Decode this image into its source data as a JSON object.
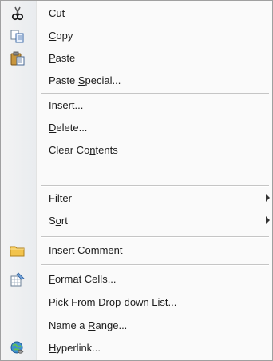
{
  "menu": {
    "items": [
      {
        "pre": "Cu",
        "mn": "t",
        "post": "",
        "icon": "cut-icon"
      },
      {
        "pre": "",
        "mn": "C",
        "post": "opy",
        "icon": "copy-icon"
      },
      {
        "pre": "",
        "mn": "P",
        "post": "aste",
        "icon": "paste-icon"
      },
      {
        "pre": "Paste ",
        "mn": "S",
        "post": "pecial...",
        "icon": ""
      },
      {
        "pre": "",
        "mn": "I",
        "post": "nsert...",
        "icon": ""
      },
      {
        "pre": "",
        "mn": "D",
        "post": "elete...",
        "icon": ""
      },
      {
        "pre": "Clear Co",
        "mn": "n",
        "post": "tents",
        "icon": ""
      },
      {
        "pre": "Filt",
        "mn": "e",
        "post": "r",
        "icon": ""
      },
      {
        "pre": "S",
        "mn": "o",
        "post": "rt",
        "icon": ""
      },
      {
        "pre": "Insert Co",
        "mn": "m",
        "post": "ment",
        "icon": "insert-comment-icon"
      },
      {
        "pre": "",
        "mn": "F",
        "post": "ormat Cells...",
        "icon": "format-cells-icon"
      },
      {
        "pre": "Pic",
        "mn": "k",
        "post": " From Drop-down List...",
        "icon": ""
      },
      {
        "pre": "Name a ",
        "mn": "R",
        "post": "ange...",
        "icon": ""
      },
      {
        "pre": "",
        "mn": "H",
        "post": "yperlink...",
        "icon": "hyperlink-icon"
      }
    ]
  }
}
